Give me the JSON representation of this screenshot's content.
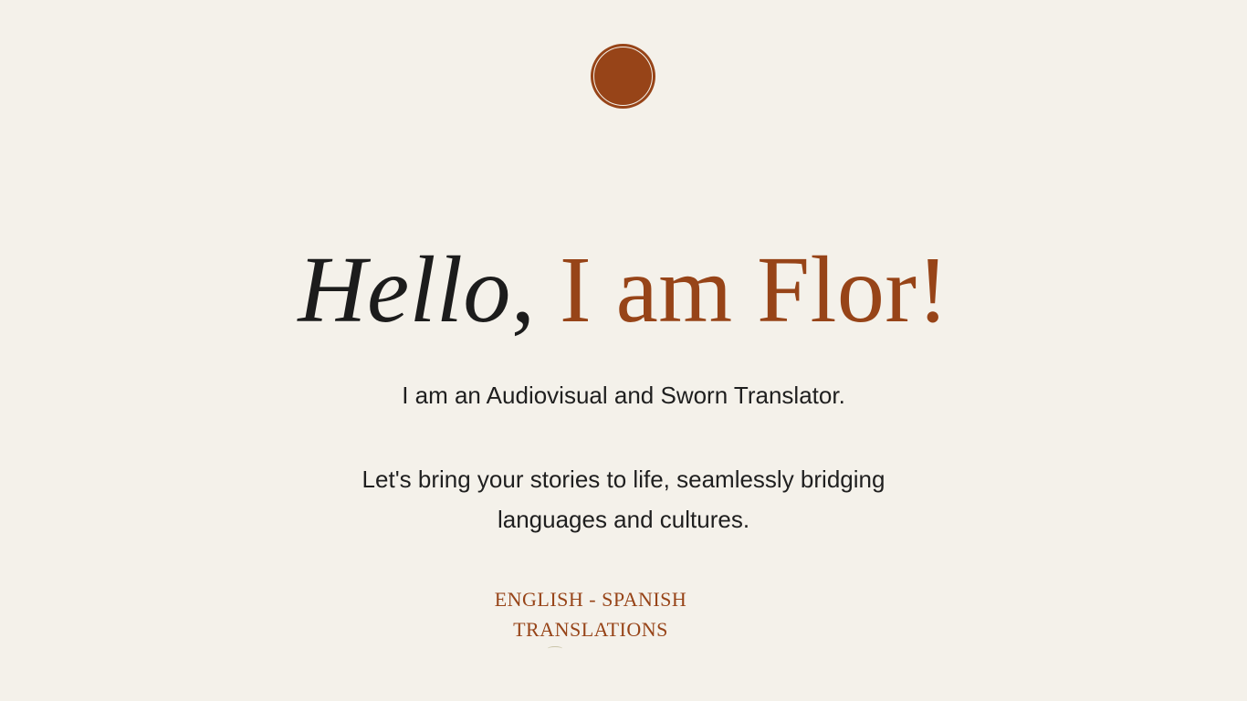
{
  "colors": {
    "background": "#f4f1ea",
    "accent": "#974418",
    "text": "#1f1f1f"
  },
  "logo": {
    "icon": "circle-logo-icon"
  },
  "hero": {
    "greeting": "Hello",
    "comma": ",",
    "name": "I am Flor!"
  },
  "subtitle": "I am an Audiovisual and Sworn Translator.",
  "tagline": {
    "line1": "Let's bring your stories to life, seamlessly bridging",
    "line2": "languages and cultures."
  },
  "services": {
    "line1": "ENGLISH - SPANISH",
    "line2": "TRANSLATIONS"
  }
}
